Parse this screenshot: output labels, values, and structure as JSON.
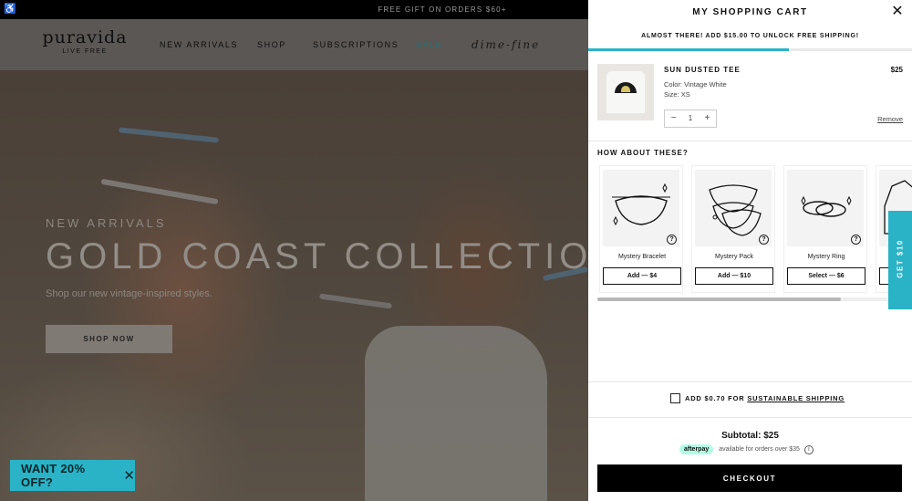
{
  "site": {
    "announcement": "FREE GIFT ON ORDERS $60+",
    "logo": {
      "name": "puravida",
      "tagline": "LIVE FREE"
    },
    "nav": [
      {
        "label": "NEW ARRIVALS"
      },
      {
        "label": "SHOP"
      },
      {
        "label": "SUBSCRIPTIONS"
      },
      {
        "label": "SALE"
      },
      {
        "label": "dime-fine"
      }
    ],
    "hero": {
      "eyebrow": "NEW ARRIVALS",
      "title": "GOLD COAST COLLECTION",
      "subtitle": "Shop our new vintage-inspired styles.",
      "cta": "SHOP NOW"
    },
    "promo": {
      "label": "WANT 20% OFF?",
      "close": "✕"
    }
  },
  "cart": {
    "title": "MY SHOPPING CART",
    "close": "✕",
    "shipping_message": "ALMOST THERE! ADD $15.00 TO UNLOCK FREE SHIPPING!",
    "shipping_progress_pct": 62,
    "item": {
      "name": "SUN DUSTED TEE",
      "price": "$25",
      "color": "Color: Vintage White",
      "size": "Size: XS",
      "quantity": "1",
      "minus": "−",
      "plus": "+",
      "remove": "Remove"
    },
    "upsell": {
      "title": "HOW ABOUT THESE?",
      "products": [
        {
          "name": "Mystery Bracelet",
          "button": "Add — $4",
          "help": "?"
        },
        {
          "name": "Mystery Pack",
          "button": "Add — $10",
          "help": "?"
        },
        {
          "name": "Mystery Ring",
          "button": "Select — $6",
          "help": "?"
        },
        {
          "name": "",
          "button": "",
          "help": ""
        }
      ],
      "scroll_position_pct": 80
    },
    "side_tab": "GET $10",
    "sustainable": {
      "prefix": "ADD $0.70 FOR",
      "link": "SUSTAINABLE SHIPPING"
    },
    "subtotal": "Subtotal:  $25",
    "afterpay": {
      "badge": "afterpay",
      "text": "available for orders over $35",
      "info": "i"
    },
    "checkout": "CHECKOUT"
  },
  "colors": {
    "accent": "#2ab3c6",
    "checkout": "#000000",
    "afterpay": "#b2fce4"
  }
}
